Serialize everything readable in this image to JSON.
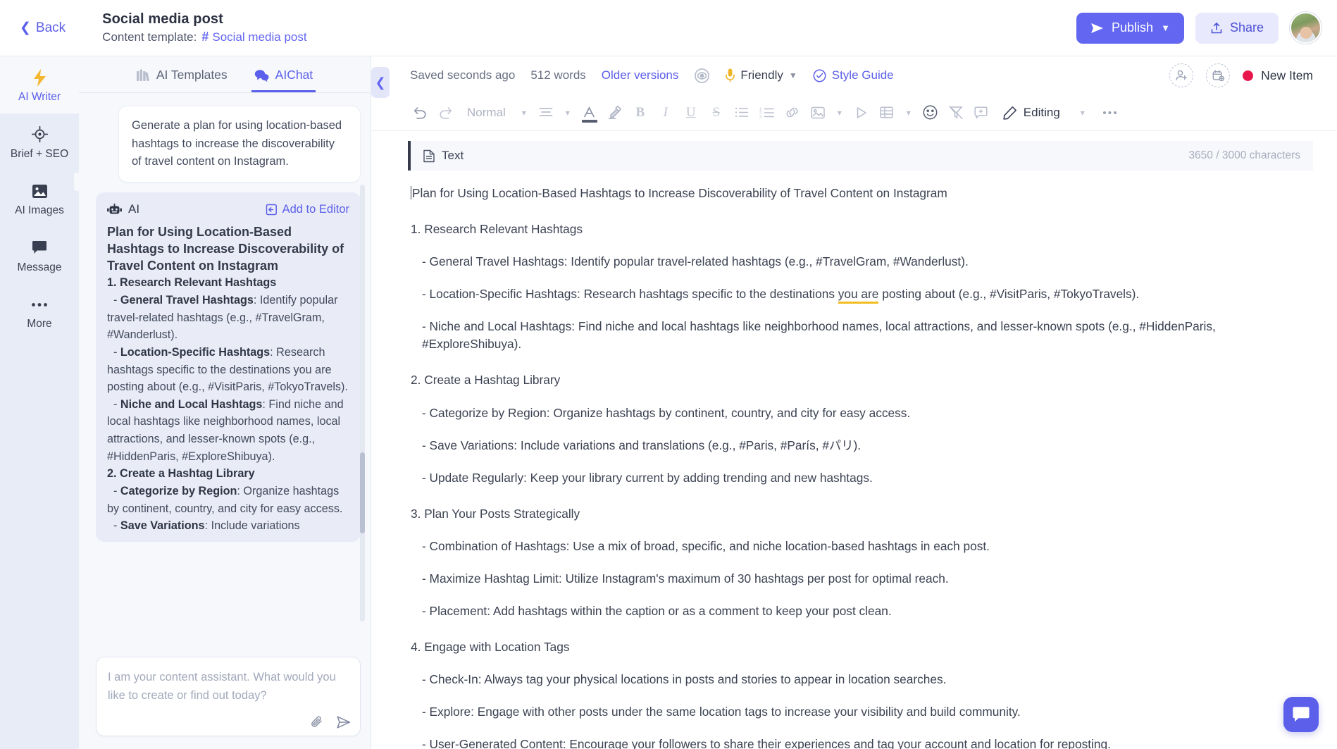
{
  "topbar": {
    "back_label": "Back",
    "doc_title": "Social media post",
    "content_template_label": "Content template:",
    "template_name": "Social media post",
    "publish_label": "Publish",
    "share_label": "Share"
  },
  "rail": {
    "items": [
      {
        "label": "AI Writer",
        "icon": "lightning-icon",
        "active": true
      },
      {
        "label": "Brief + SEO",
        "icon": "target-icon",
        "active": false
      },
      {
        "label": "AI Images",
        "icon": "image-icon",
        "active": false
      },
      {
        "label": "Message",
        "icon": "chat-bubble-icon",
        "active": false
      },
      {
        "label": "More",
        "icon": "ellipsis-icon",
        "active": false
      }
    ]
  },
  "chat": {
    "tabs": [
      {
        "label": "AI Templates",
        "icon": "templates-icon",
        "active": false
      },
      {
        "label": "AIChat",
        "icon": "chat-icon",
        "active": true
      }
    ],
    "user_message": "Generate a plan for using location-based hashtags to increase the discoverability of travel content on Instagram.",
    "ai_label": "AI",
    "add_to_editor_label": "Add to Editor",
    "ai_title": "Plan for Using Location-Based Hashtags to Increase Discoverability of Travel Content on Instagram",
    "ai_sections": [
      {
        "heading": "1. Research Relevant Hashtags",
        "bullets": [
          {
            "term": "General Travel Hashtags",
            "text": ": Identify popular travel-related hashtags (e.g., #TravelGram, #Wanderlust)."
          },
          {
            "term": "Location-Specific Hashtags",
            "text": ": Research hashtags specific to the destinations you are posting about (e.g., #VisitParis, #TokyoTravels)."
          },
          {
            "term": "Niche and Local Hashtags",
            "text": ": Find niche and local hashtags like neighborhood names, local attractions, and lesser-known spots (e.g., #HiddenParis, #ExploreShibuya)."
          }
        ]
      },
      {
        "heading": "2. Create a Hashtag Library",
        "bullets": [
          {
            "term": "Categorize by Region",
            "text": ": Organize hashtags by continent, country, and city for easy access."
          },
          {
            "term": "Save Variations",
            "text": ": Include variations"
          }
        ]
      }
    ],
    "composer_placeholder": "I am your content assistant. What would you like to create or find out today?"
  },
  "editor": {
    "saved_status": "Saved seconds ago",
    "word_count": "512 words",
    "older_versions": "Older versions",
    "tone": "Friendly",
    "style_guide": "Style Guide",
    "new_item": "New Item",
    "new_item_color": "#e8174b",
    "accent_color": "#6366f1",
    "toolbar": {
      "paragraph_style": "Normal",
      "mode_label": "Editing",
      "icons": [
        "undo-icon",
        "redo-icon",
        "align-icon",
        "text-color-icon",
        "highlight-icon",
        "bold-icon",
        "italic-icon",
        "underline-icon",
        "strikethrough-icon",
        "bullet-list-icon",
        "numbered-list-icon",
        "link-icon",
        "image-icon",
        "video-icon",
        "table-icon",
        "emoji-icon",
        "clear-format-icon",
        "comment-icon",
        "pencil-icon",
        "more-icon"
      ]
    },
    "text_block": {
      "label": "Text",
      "char_count": "3650 / 3000 characters"
    },
    "document": {
      "title": "Plan for Using Location-Based Hashtags to Increase Discoverability of Travel Content on Instagram",
      "sections": [
        {
          "heading": "1. Research Relevant Hashtags",
          "items": [
            "- General Travel Hashtags: Identify popular travel-related hashtags (e.g., #TravelGram, #Wanderlust).",
            "- Location-Specific Hashtags: Research hashtags specific to the destinations you are posting about (e.g., #VisitParis, #TokyoTravels).",
            "- Niche and Local Hashtags: Find niche and local hashtags like neighborhood names, local attractions, and lesser-known spots (e.g., #HiddenParis, #ExploreShibuya)."
          ]
        },
        {
          "heading": "2. Create a Hashtag Library",
          "items": [
            "- Categorize by Region: Organize hashtags by continent, country, and city for easy access.",
            "- Save Variations: Include variations and translations (e.g., #Paris, #París, #パリ).",
            "- Update Regularly: Keep your library current by adding trending and new hashtags."
          ]
        },
        {
          "heading": "3. Plan Your Posts Strategically",
          "items": [
            "- Combination of Hashtags: Use a mix of broad, specific, and niche location-based hashtags in each post.",
            "- Maximize Hashtag Limit: Utilize Instagram's maximum of 30 hashtags per post for optimal reach.",
            "- Placement: Add hashtags within the caption or as a comment to keep your post clean."
          ]
        },
        {
          "heading": "4. Engage with Location Tags",
          "items": [
            "- Check-In: Always tag your physical locations in posts and stories to appear in location searches.",
            "- Explore: Engage with other posts under the same location tags to increase your visibility and build community.",
            "- User-Generated Content: Encourage your followers to share their experiences and tag your account and location for reposting."
          ]
        }
      ],
      "grammar_highlight": "you are"
    }
  }
}
